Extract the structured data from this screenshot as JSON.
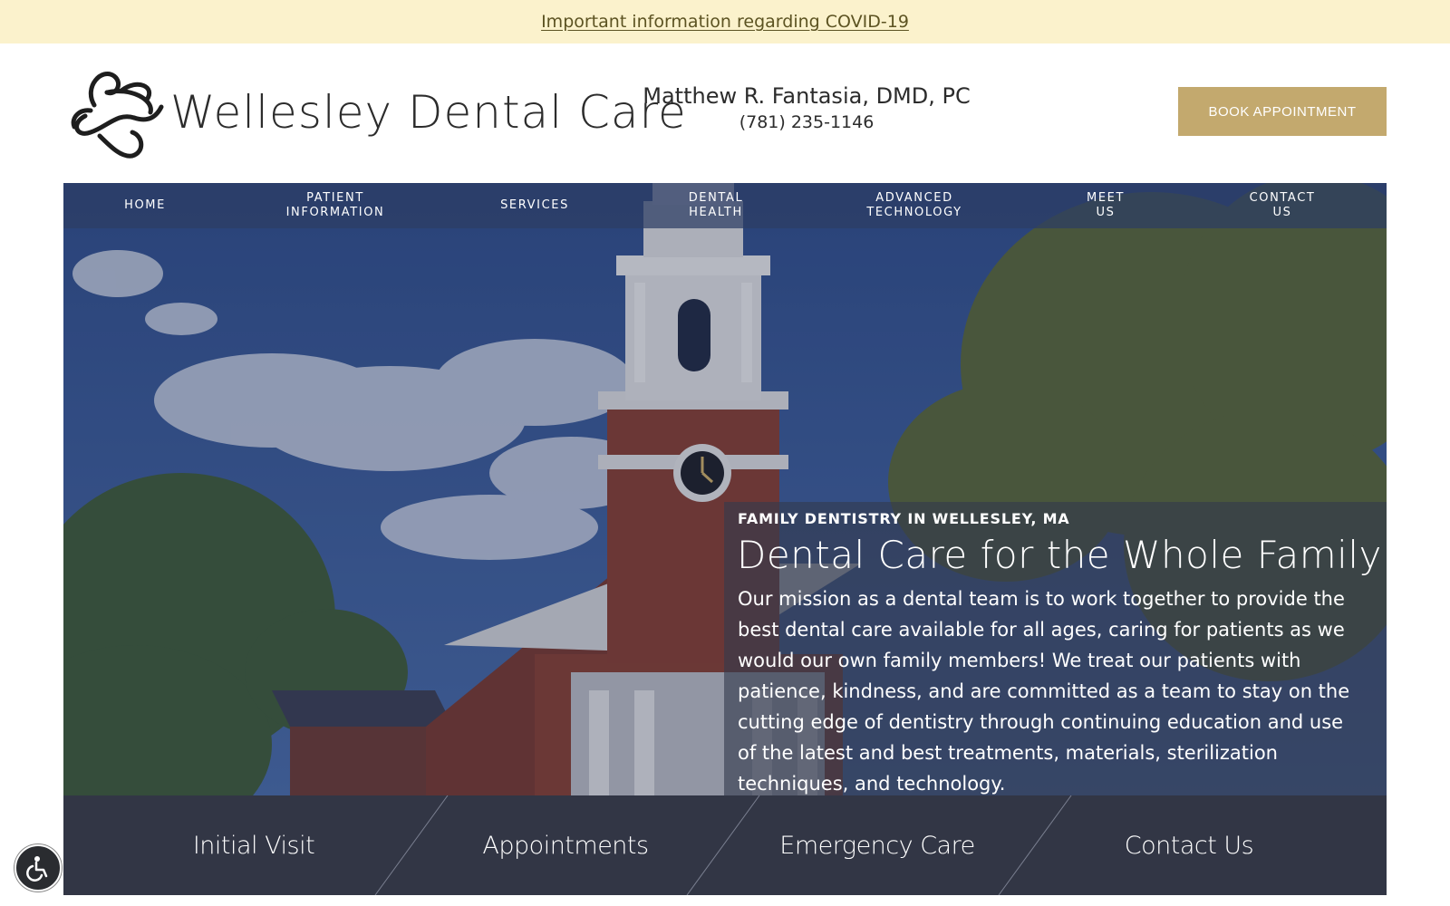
{
  "covid_banner": {
    "link_text": "Important information regarding COVID-19"
  },
  "logo": {
    "text": "Wellesley Dental Care",
    "icon": "tooth-swirl-logo"
  },
  "doctor": {
    "name": "Matthew R. Fantasia, DMD, PC",
    "phone": "(781) 235-1146"
  },
  "book_button": {
    "label": "BOOK APPOINTMENT"
  },
  "nav": {
    "items": [
      {
        "label": "HOME"
      },
      {
        "label": "PATIENT\nINFORMATION"
      },
      {
        "label": "SERVICES"
      },
      {
        "label": "DENTAL\nHEALTH"
      },
      {
        "label": "ADVANCED\nTECHNOLOGY"
      },
      {
        "label": "MEET\nUS"
      },
      {
        "label": "CONTACT\nUS"
      }
    ]
  },
  "hero": {
    "kicker": "FAMILY DENTISTRY IN WELLESLEY, MA",
    "title": "Dental Care for the Whole Family",
    "body": "Our mission as a dental team is to work together to provide the best dental care available for all ages, caring for patients as we would our own family members! We treat our patients with patience, kindness, and are committed as a team to stay on the cutting edge of dentistry through continuing education and use of the latest and best treatments, materials, sterilization techniques, and technology."
  },
  "quick_links": [
    {
      "label": "Initial Visit"
    },
    {
      "label": "Appointments"
    },
    {
      "label": "Emergency Care"
    },
    {
      "label": "Contact Us"
    }
  ],
  "accessibility": {
    "icon": "wheelchair-icon"
  },
  "colors": {
    "banner_bg": "#fbf2cc",
    "accent_gold": "#c3a96e",
    "nav_bg": "#2d3d64",
    "quick_bg": "#323645"
  }
}
